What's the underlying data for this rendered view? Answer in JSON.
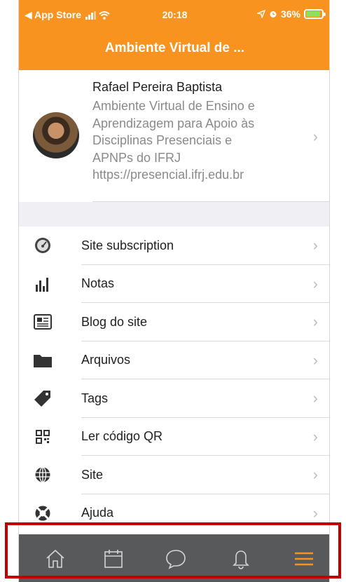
{
  "status_bar": {
    "back_app": "◀ App Store",
    "time": "20:18",
    "battery": "36%"
  },
  "header": {
    "title": "Ambiente Virtual de ..."
  },
  "profile": {
    "name": "Rafael Pereira Baptista",
    "site_lines": [
      "Ambiente Virtual de Ensino e",
      "Aprendizagem para Apoio às",
      "Disciplinas Presenciais e",
      "APNPs do IFRJ",
      "https://presencial.ifrj.edu.br"
    ]
  },
  "menu": {
    "items": [
      {
        "label": "Site subscription",
        "icon": "gauge-icon"
      },
      {
        "label": "Notas",
        "icon": "bar-chart-icon"
      },
      {
        "label": "Blog do site",
        "icon": "newspaper-icon"
      },
      {
        "label": "Arquivos",
        "icon": "folder-icon"
      },
      {
        "label": "Tags",
        "icon": "tag-icon"
      },
      {
        "label": "Ler código QR",
        "icon": "qr-code-icon"
      },
      {
        "label": "Site",
        "icon": "globe-icon"
      },
      {
        "label": "Ajuda",
        "icon": "lifebuoy-icon"
      }
    ]
  },
  "tabbar": {
    "tabs": [
      {
        "icon": "home-icon"
      },
      {
        "icon": "calendar-icon"
      },
      {
        "icon": "messages-icon"
      },
      {
        "icon": "notifications-icon"
      },
      {
        "icon": "more-menu-icon",
        "active": true
      }
    ]
  },
  "colors": {
    "brand": "#f7931e",
    "tabbar": "#58595b",
    "active_tab": "#f7931e",
    "highlight": "#c00000"
  }
}
